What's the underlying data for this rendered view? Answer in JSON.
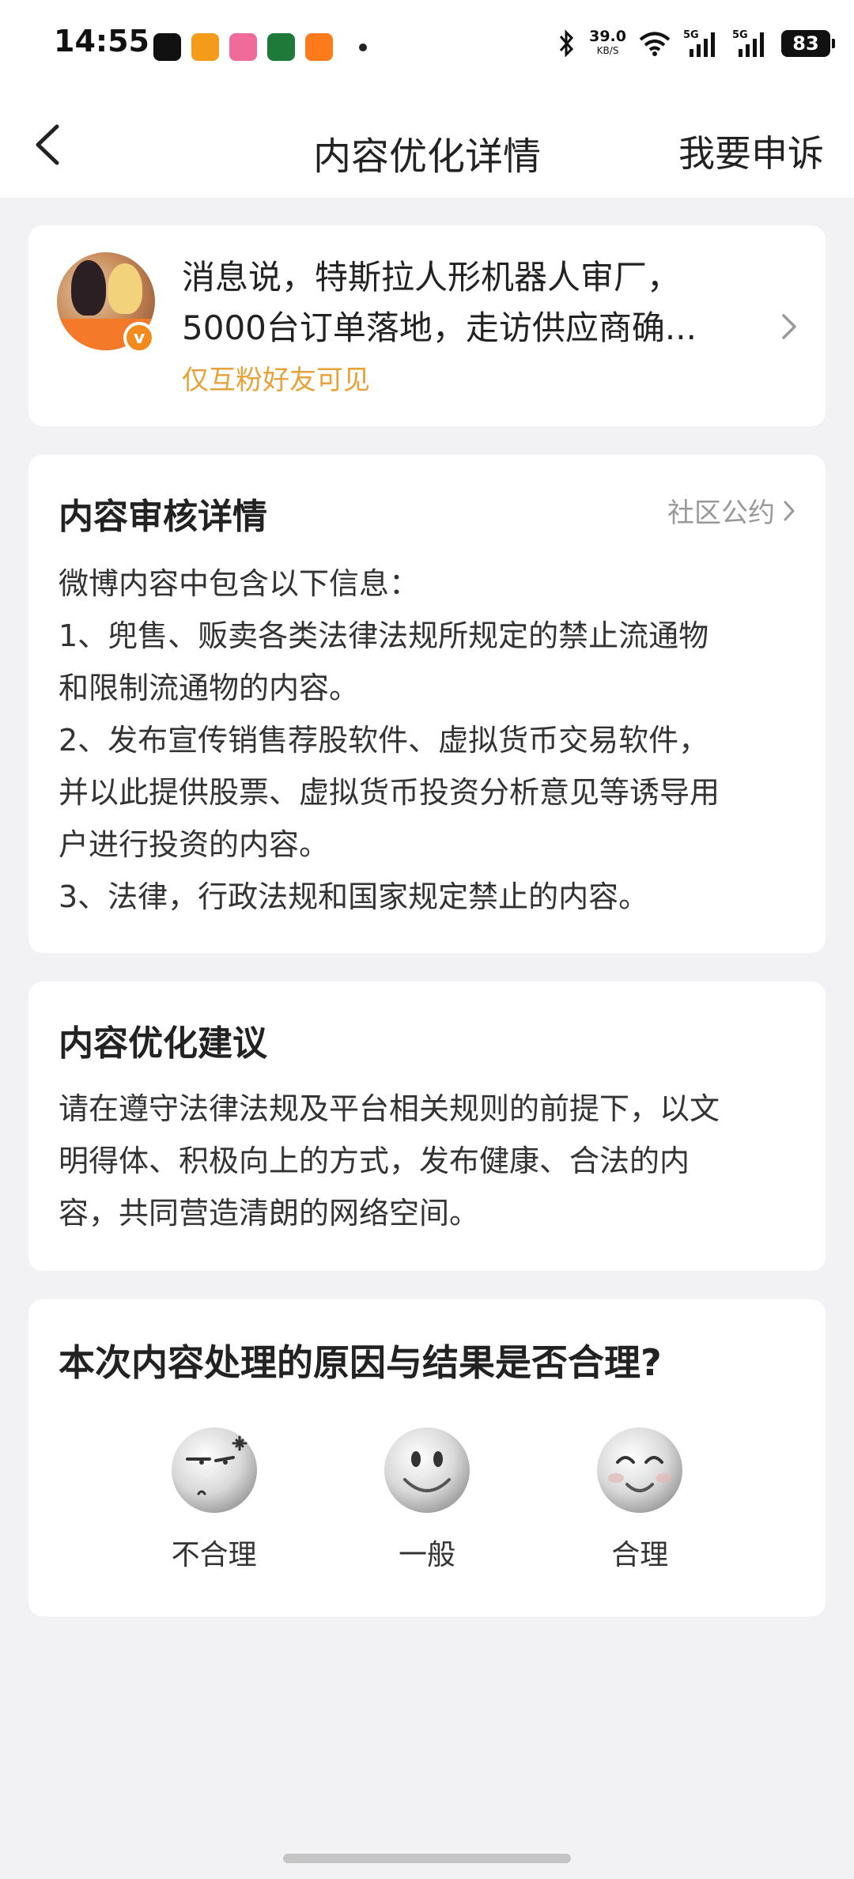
{
  "status_bar": {
    "time": "14:55",
    "net_speed_value": "39.0",
    "net_speed_unit": "KB/S",
    "battery": "83",
    "app_icon_colors": [
      "#111111",
      "#f59b1a",
      "#f06b9a",
      "#1f7a3a",
      "#ff7a1a"
    ]
  },
  "nav": {
    "title": "内容优化详情",
    "appeal_label": "我要申诉"
  },
  "post": {
    "text_line1": "消息说，特斯拉人形机器人审厂，",
    "text_line2": "5000台订单落地，走访供应商确...",
    "visibility": "仅互粉好友可见"
  },
  "review": {
    "title": "内容审核详情",
    "community_link": "社区公约",
    "lines": [
      "微博内容中包含以下信息：",
      "1、兜售、贩卖各类法律法规所规定的禁止流通物",
      "和限制流通物的内容。",
      "2、发布宣传销售荐股软件、虚拟货币交易软件，",
      "并以此提供股票、虚拟货币投资分析意见等诱导用",
      "户进行投资的内容。",
      "3、法律，行政法规和国家规定禁止的内容。"
    ]
  },
  "suggestion": {
    "title": "内容优化建议",
    "lines": [
      "请在遵守法律法规及平台相关规则的前提下，以文",
      "明得体、积极向上的方式，发布健康、合法的内",
      "容，共同营造清朗的网络空间。"
    ]
  },
  "rating": {
    "question": "本次内容处理的原因与结果是否合理?",
    "options": [
      {
        "label": "不合理",
        "icon": "annoyed-face-icon"
      },
      {
        "label": "一般",
        "icon": "neutral-smile-face-icon"
      },
      {
        "label": "合理",
        "icon": "happy-face-icon"
      }
    ]
  },
  "colors": {
    "accent_orange": "#e8a23a",
    "page_background": "#f2f2f4"
  }
}
